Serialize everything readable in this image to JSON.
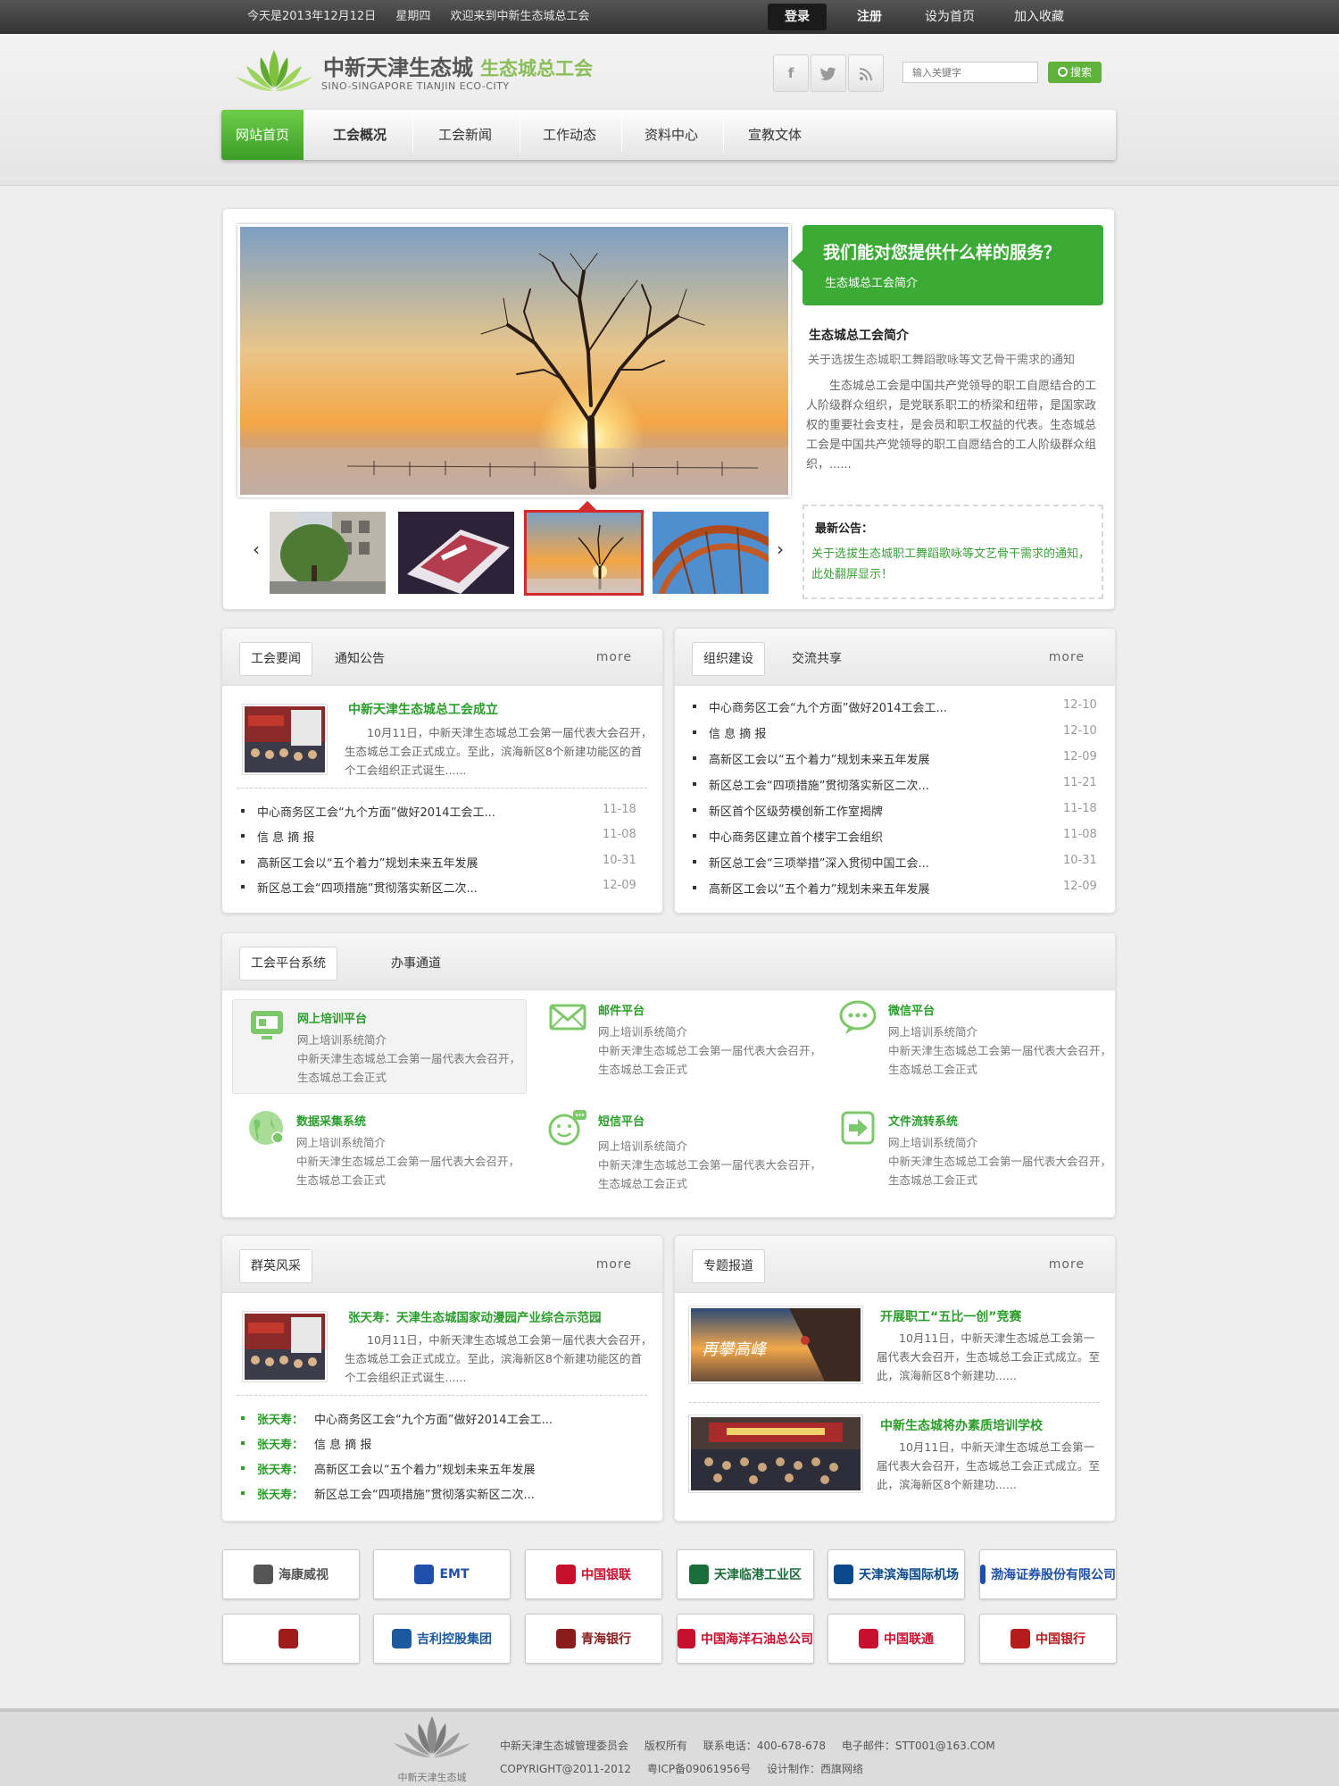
{
  "topbar": {
    "date": "今天是2013年12月12日",
    "weekday": "星期四",
    "welcome": "欢迎来到中新生态城总工会",
    "login": "登录",
    "register": "注册",
    "set_home": "设为首页",
    "favorite": "加入收藏"
  },
  "header": {
    "logo_cn": "中新天津生态城",
    "logo_cn2": "生态城总工会",
    "logo_en": "SINO-SINGAPORE TIANJIN ECO-CITY",
    "search_placeholder": "输入关键字",
    "search_button": "搜索",
    "social": [
      "facebook-icon",
      "twitter-icon",
      "rss-icon"
    ]
  },
  "nav": [
    "网站首页",
    "工会概况",
    "工会新闻",
    "工作动态",
    "资料中心",
    "宣教文体"
  ],
  "hero": {
    "service_question": "我们能对您提供什么样的服务？",
    "service_sub": "生态城总工会简介",
    "intro_title": "生态城总工会简介",
    "intro_sub": "关于选拔生态城职工舞蹈歌咏等文艺骨干需求的通知",
    "intro_text": "生态城总工会是中国共产党领导的职工自愿结合的工人阶级群众组织，是党联系职工的桥梁和纽带，是国家政权的重要社会支柱，是会员和职工权益的代表。生态城总工会是中国共产党领导的职工自愿结合的工人阶级群众组织，......",
    "notice_title": "最新公告：",
    "notice_text": "关于选拔生态城职工舞蹈歌咏等文艺骨干需求的通知，此处翻屏显示！",
    "selected_thumb": 2
  },
  "news": {
    "tab_active": "工会要闻",
    "tab_other": "通知公告",
    "more": "more",
    "feature_title": "中新天津生态城总工会成立",
    "feature_text": "10月11日，中新天津生态城总工会第一届代表大会召开，生态城总工会正式成立。至此，滨海新区8个新建功能区的首个工会组织正式诞生......",
    "items": [
      {
        "title": "中心商务区工会“九个方面”做好2014工会工...",
        "date": "11-18"
      },
      {
        "title": "信 息 摘 报",
        "date": "11-08"
      },
      {
        "title": "高新区工会以“五个着力”规划未来五年发展",
        "date": "10-31"
      },
      {
        "title": "新区总工会“四项措施”贯彻落实新区二次...",
        "date": "12-09"
      }
    ]
  },
  "org": {
    "tab_active": "组织建设",
    "tab_other": "交流共享",
    "more": "more",
    "items": [
      {
        "title": "中心商务区工会“九个方面”做好2014工会工...",
        "date": "12-10"
      },
      {
        "title": "信 息 摘 报",
        "date": "12-10"
      },
      {
        "title": "高新区工会以“五个着力”规划未来五年发展",
        "date": "12-09"
      },
      {
        "title": "新区总工会“四项措施”贯彻落实新区二次...",
        "date": "11-21"
      },
      {
        "title": "新区首个区级劳模创新工作室揭牌",
        "date": "11-18"
      },
      {
        "title": "中心商务区建立首个楼宇工会组织",
        "date": "11-08"
      },
      {
        "title": "新区总工会“三项举措”深入贯彻中国工会...",
        "date": "10-31"
      },
      {
        "title": "高新区工会以“五个着力”规划未来五年发展",
        "date": "12-09"
      }
    ]
  },
  "platform": {
    "tab_active": "工会平台系统",
    "tab_other": "办事通道",
    "items": [
      {
        "title": "网上培训平台",
        "sub": "网上培训系统简介",
        "desc": "中新天津生态城总工会第一届代表大会召开，生态城总工会正式",
        "icon": "monitor-icon"
      },
      {
        "title": "邮件平台",
        "sub": "网上培训系统简介",
        "desc": "中新天津生态城总工会第一届代表大会召开，生态城总工会正式",
        "icon": "mail-icon"
      },
      {
        "title": "微信平台",
        "sub": "网上培训系统简介",
        "desc": "中新天津生态城总工会第一届代表大会召开，生态城总工会正式",
        "icon": "chat-icon"
      },
      {
        "title": "数据采集系统",
        "sub": "网上培训系统简介",
        "desc": "中新天津生态城总工会第一届代表大会召开，生态城总工会正式",
        "icon": "globe-icon"
      },
      {
        "title": "短信平台",
        "sub": "网上培训系统简介",
        "desc": "中新天津生态城总工会第一届代表大会召开，生态城总工会正式",
        "icon": "sms-icon"
      },
      {
        "title": "文件流转系统",
        "sub": "网上培训系统简介",
        "desc": "中新天津生态城总工会第一届代表大会召开，生态城总工会正式",
        "icon": "file-transfer-icon"
      }
    ]
  },
  "people": {
    "tab_active": "群英风采",
    "more": "more",
    "feature_title": "张天寿：天津生态城国家动漫园产业综合示范园",
    "feature_text": "10月11日，中新天津生态城总工会第一届代表大会召开，生态城总工会正式成立。至此，滨海新区8个新建功能区的首个工会组织正式诞生......",
    "items": [
      {
        "name": "张天寿：",
        "title": "中心商务区工会“九个方面”做好2014工会工..."
      },
      {
        "name": "张天寿：",
        "title": "信 息 摘 报"
      },
      {
        "name": "张天寿：",
        "title": "高新区工会以“五个着力”规划未来五年发展"
      },
      {
        "name": "张天寿：",
        "title": "新区总工会“四项措施”贯彻落实新区二次..."
      }
    ]
  },
  "special": {
    "tab_active": "专题报道",
    "more": "more",
    "items": [
      {
        "title": "开展职工“五比一创”竞赛",
        "text": "10月11日，中新天津生态城总工会第一届代表大会召开，生态城总工会正式成立。至此，滨海新区8个新建功......",
        "img_caption": "再攀高峰"
      },
      {
        "title": "中新生态城将办素质培训学校",
        "text": "10月11日，中新天津生态城总工会第一届代表大会召开，生态城总工会正式成立。至此，滨海新区8个新建功......"
      }
    ]
  },
  "partners": [
    {
      "name": "海康威视",
      "color": "#555555"
    },
    {
      "name": "EMT",
      "color": "#1f4fa8"
    },
    {
      "name": "中国银联",
      "color": "#c8102e"
    },
    {
      "name": "天津临港工业区",
      "color": "#1a6e3a"
    },
    {
      "name": "天津滨海国际机场",
      "color": "#0a4a8c"
    },
    {
      "name": "渤海证券股份有限公司",
      "color": "#1f4fa8"
    },
    {
      "name": "",
      "color": "#a01c1c"
    },
    {
      "name": "吉利控股集团",
      "color": "#1c5aa0"
    },
    {
      "name": "青海银行",
      "color": "#8a1c1c"
    },
    {
      "name": "中国海洋石油总公司",
      "color": "#c8102e"
    },
    {
      "name": "中国联通",
      "color": "#c8102e"
    },
    {
      "name": "中国银行",
      "color": "#b71c1c"
    }
  ],
  "footer": {
    "org": "中新天津生态城管理委员会",
    "rights": "版权所有",
    "phone": "联系电话：400-678-678",
    "email": "电子邮件：STT001@163.COM",
    "copyright": "COPYRIGHT@2011-2012",
    "icp": "粤ICP备09061956号",
    "design": "设计制作：西旗网络",
    "logo_text": "中新天津生态城"
  }
}
